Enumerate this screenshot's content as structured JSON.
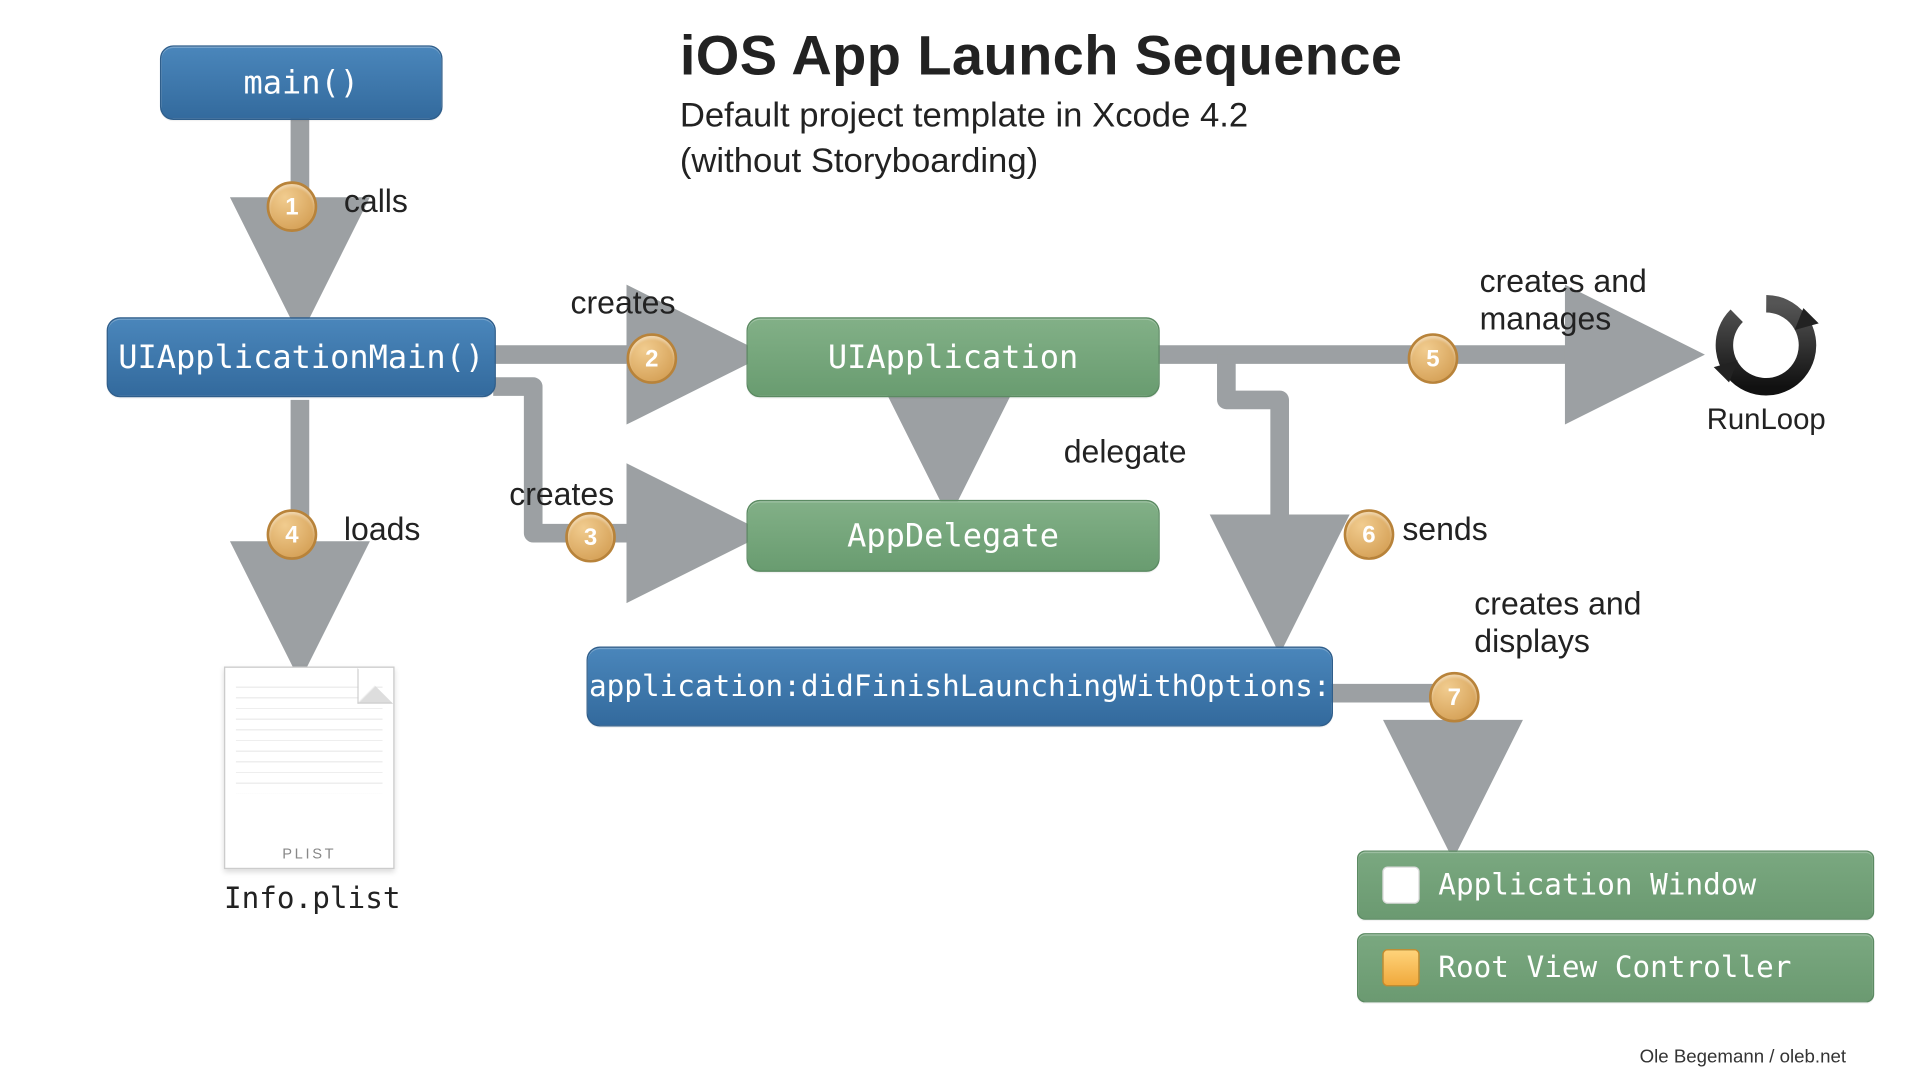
{
  "title": "iOS App Launch Sequence",
  "subtitle_line1": "Default project template in Xcode 4.2",
  "subtitle_line2": "(without Storyboarding)",
  "credit": "Ole Begemann / oleb.net",
  "nodes": {
    "main": "main()",
    "uiAppMain": "UIApplicationMain()",
    "uiApplication": "UIApplication",
    "appDelegate": "AppDelegate",
    "didFinish": "application:didFinishLaunchingWithOptions:",
    "infoPlist": "Info.plist",
    "plistTag": "PLIST",
    "runLoop": "RunLoop",
    "appWindow": "Application Window",
    "rootVC": "Root View Controller"
  },
  "edges": {
    "e1": "calls",
    "e2": "creates",
    "e3": "creates",
    "e4": "loads",
    "e5_l1": "creates and",
    "e5_l2": "manages",
    "delegate": "delegate",
    "e6": "sends",
    "e7_l1": "creates and",
    "e7_l2": "displays"
  },
  "badges": {
    "b1": "1",
    "b2": "2",
    "b3": "3",
    "b4": "4",
    "b5": "5",
    "b6": "6",
    "b7": "7"
  }
}
